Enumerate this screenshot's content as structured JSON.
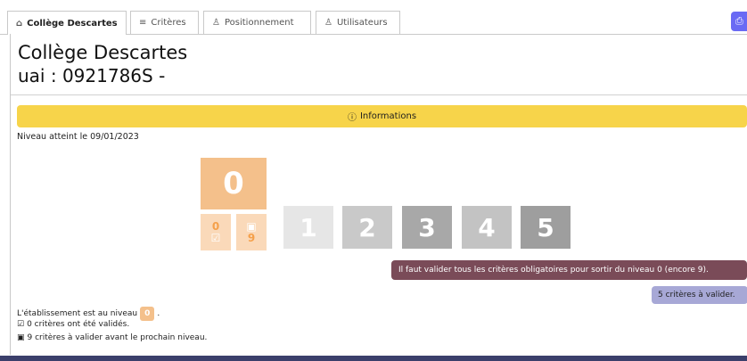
{
  "tabs": [
    {
      "icon": "⌂",
      "label": "Collège Descartes",
      "active": true
    },
    {
      "icon": "≡",
      "label": "Critères",
      "active": false
    },
    {
      "icon": "♙",
      "label": "Positionnement",
      "active": false
    },
    {
      "icon": "♙",
      "label": "Utilisateurs",
      "active": false
    }
  ],
  "print_icon": "⎙",
  "header": {
    "title": "Collège Descartes",
    "subtitle": "uai : 0921786S -"
  },
  "info_banner": {
    "icon": "ⓘ",
    "label": "Informations"
  },
  "niveau_date": "Niveau atteint le 09/01/2023",
  "current_level": {
    "value": "0",
    "validated_count": "0",
    "remaining_count": "9"
  },
  "levels": [
    "1",
    "2",
    "3",
    "4",
    "5"
  ],
  "level_colors": [
    "#e6e6e6",
    "#c9c9c9",
    "#a8a8a8",
    "#c3c3c3",
    "#9e9e9e"
  ],
  "badges": {
    "required": "Il faut valider tous les critères obligatoires pour sortir du niveau 0 (encore 9).",
    "to_validate": "5 critères à valider."
  },
  "summary": {
    "level_text": "L'établissement est au niveau",
    "level_value": "0",
    "level_suffix": ".",
    "validated_icon": "☑",
    "validated_text": "0 critères ont été validés.",
    "remaining_icon": "📋",
    "remaining_text": "9 critères à valider avant le prochain niveau."
  }
}
